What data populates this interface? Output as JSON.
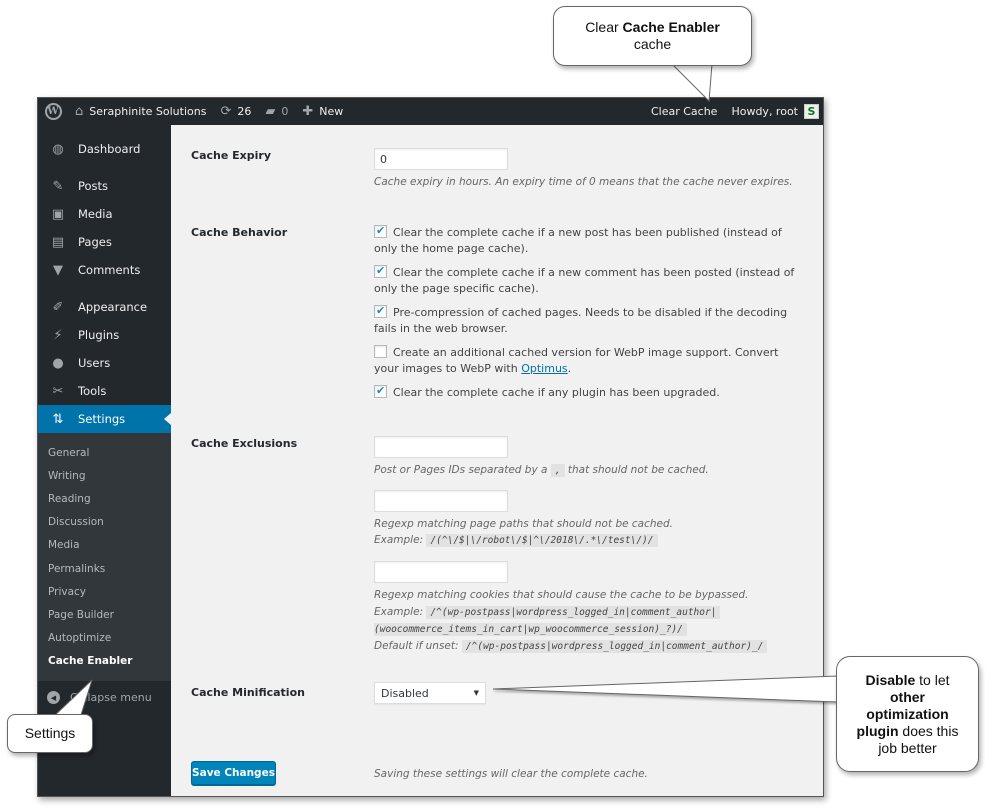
{
  "adminbar": {
    "wp_logo": "wordpress-logo",
    "site_name": "Seraphinite Solutions",
    "updates_count": "26",
    "comments_count": "0",
    "new_label": "New",
    "clear_cache_label": "Clear Cache",
    "howdy": "Howdy, root",
    "avatar_glyph": "S"
  },
  "sidebar": {
    "items": [
      {
        "label": "Dashboard",
        "icon": "dashboard-icon",
        "glyph": "◍"
      },
      {
        "label": "Posts",
        "icon": "pin-icon",
        "glyph": "✎"
      },
      {
        "label": "Media",
        "icon": "media-icon",
        "glyph": "▣"
      },
      {
        "label": "Pages",
        "icon": "pages-icon",
        "glyph": "▤"
      },
      {
        "label": "Comments",
        "icon": "comment-icon",
        "glyph": "▼"
      },
      {
        "label": "Appearance",
        "icon": "brush-icon",
        "glyph": "✐"
      },
      {
        "label": "Plugins",
        "icon": "plug-icon",
        "glyph": "⚡"
      },
      {
        "label": "Users",
        "icon": "user-icon",
        "glyph": "●"
      },
      {
        "label": "Tools",
        "icon": "wrench-icon",
        "glyph": "✂"
      },
      {
        "label": "Settings",
        "icon": "settings-icon",
        "glyph": "⇅"
      }
    ],
    "submenu": [
      "General",
      "Writing",
      "Reading",
      "Discussion",
      "Media",
      "Permalinks",
      "Privacy",
      "Page Builder",
      "Autoptimize",
      "Cache Enabler"
    ],
    "collapse_label": "Collapse menu"
  },
  "settings": {
    "expiry": {
      "label": "Cache Expiry",
      "value": "0",
      "description": "Cache expiry in hours. An expiry time of 0 means that the cache never expires."
    },
    "behavior": {
      "label": "Cache Behavior",
      "options": [
        {
          "checked": true,
          "text": "Clear the complete cache if a new post has been published (instead of only the home page cache)."
        },
        {
          "checked": true,
          "text": "Clear the complete cache if a new comment has been posted (instead of only the page specific cache)."
        },
        {
          "checked": true,
          "text": "Pre-compression of cached pages. Needs to be disabled if the decoding fails in the web browser."
        },
        {
          "checked": false,
          "text": "Create an additional cached version for WebP image support. Convert your images to WebP with ",
          "link": "Optimus",
          "suffix": "."
        },
        {
          "checked": true,
          "text": "Clear the complete cache if any plugin has been upgraded."
        }
      ]
    },
    "exclusions": {
      "label": "Cache Exclusions",
      "ids_value": "",
      "ids_desc_before": "Post or Pages IDs separated by a",
      "ids_desc_code": ",",
      "ids_desc_after": "that should not be cached.",
      "paths_value": "",
      "paths_desc": "Regexp matching page paths that should not be cached.",
      "paths_example_label": "Example:",
      "paths_example_code": "/(^\\/$|\\/robot\\/$|^\\/2018\\/.*\\/test\\/)/",
      "cookies_value": "",
      "cookies_desc": "Regexp matching cookies that should cause the cache to be bypassed.",
      "cookies_example_label": "Example:",
      "cookies_example_code_1": "/^(wp-postpass|wordpress_logged_in|comment_author|",
      "cookies_example_code_2": "(woocommerce_items_in_cart|wp_woocommerce_session)_?)/",
      "cookies_default_label": "Default if unset:",
      "cookies_default_code": "/^(wp-postpass|wordpress_logged_in|comment_author)_/"
    },
    "minification": {
      "label": "Cache Minification",
      "selected": "Disabled"
    },
    "save_label": "Save Changes",
    "save_note": "Saving these settings will clear the complete cache."
  },
  "callouts": {
    "top": {
      "pre": "Clear ",
      "bold": "Cache Enabler",
      "post": " cache"
    },
    "left": {
      "text": "Settings"
    },
    "right": {
      "b1": "Disable",
      "t1": " to let ",
      "b2": "other optimization plugin",
      "t2": " does this job better"
    }
  }
}
